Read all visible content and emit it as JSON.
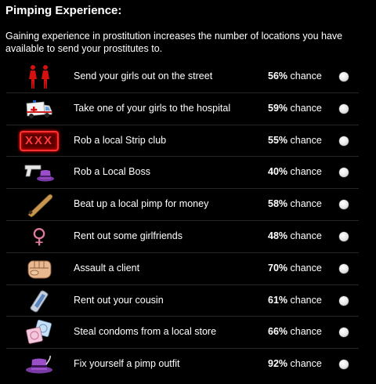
{
  "panel": {
    "title": "Pimping Experience:",
    "description": "Gaining experience in prostitution increases the number of locations you have available to send your prostitutes to."
  },
  "chance_suffix": "chance",
  "jobs": [
    {
      "label": "Send your girls out on the street",
      "percent": "56%",
      "icon": "street-girls-icon"
    },
    {
      "label": "Take one of your girls to the hospital",
      "percent": "59%",
      "icon": "ambulance-icon"
    },
    {
      "label": "Rob a local Strip club",
      "percent": "55%",
      "icon": "xxx-sign-icon",
      "icon_text": "XXX"
    },
    {
      "label": "Rob a Local Boss",
      "percent": "40%",
      "icon": "gun-hat-icon"
    },
    {
      "label": "Beat up a local pimp for money",
      "percent": "58%",
      "icon": "baseball-bat-icon"
    },
    {
      "label": "Rent out some girlfriends",
      "percent": "48%",
      "icon": "female-symbol-icon",
      "icon_text": "♀"
    },
    {
      "label": "Assault a client",
      "percent": "70%",
      "icon": "fist-icon"
    },
    {
      "label": "Rent out your cousin",
      "percent": "61%",
      "icon": "phone-icon"
    },
    {
      "label": "Steal condoms from a local store",
      "percent": "66%",
      "icon": "condom-icon"
    },
    {
      "label": "Fix yourself a pimp outfit",
      "percent": "92%",
      "icon": "pimp-hat-icon"
    }
  ],
  "colors": {
    "background": "#000000",
    "text": "#ffffff",
    "neon_red": "#ff3030",
    "hat_purple": "#8a3fb3"
  }
}
